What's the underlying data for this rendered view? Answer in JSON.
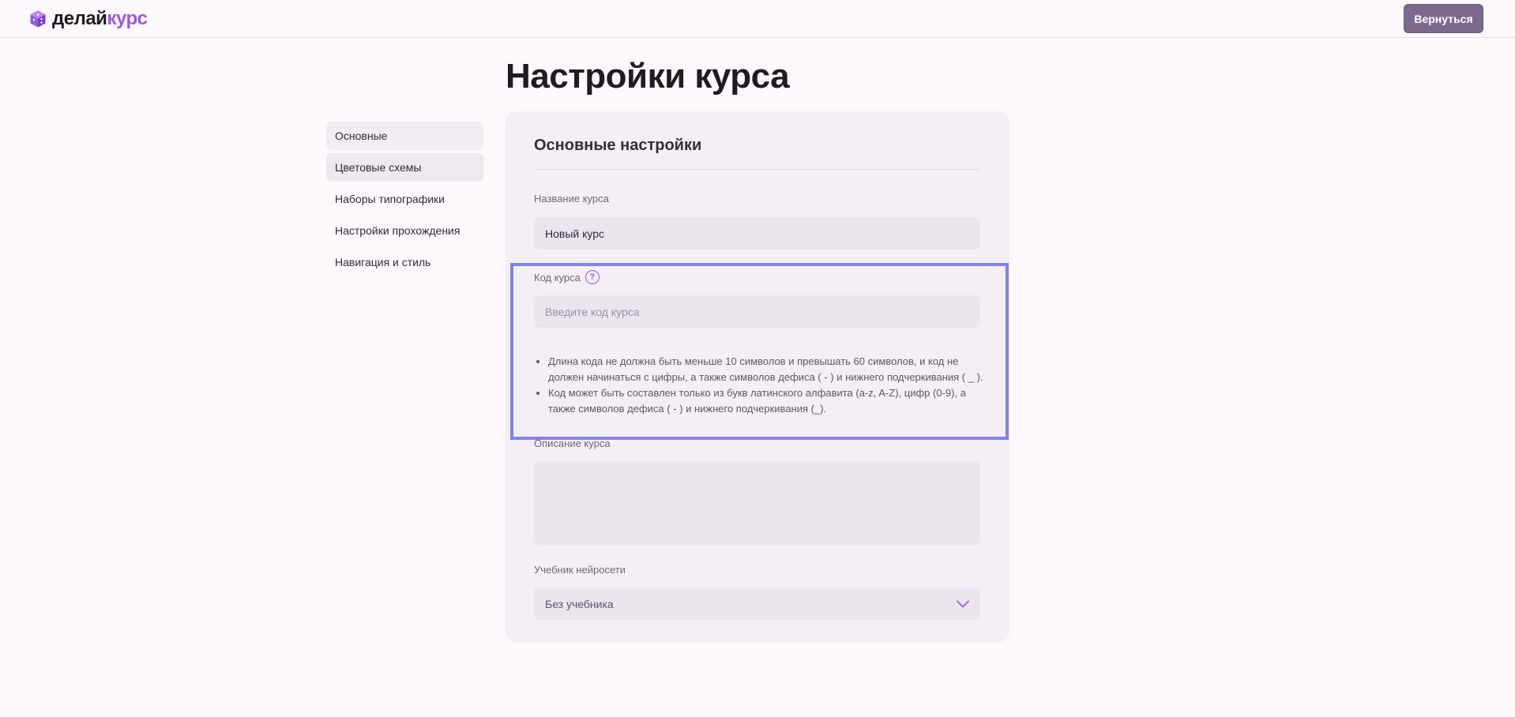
{
  "header": {
    "logo_part1": "делай",
    "logo_part2": "курс",
    "back_label": "Вернуться"
  },
  "page": {
    "title": "Настройки курса"
  },
  "sidebar": {
    "items": [
      {
        "label": "Основные"
      },
      {
        "label": "Цветовые схемы"
      },
      {
        "label": "Наборы типографики"
      },
      {
        "label": "Настройки прохождения"
      },
      {
        "label": "Навигация и стиль"
      }
    ]
  },
  "card": {
    "title": "Основные настройки",
    "course_name": {
      "label": "Название курса",
      "value": "Новый курс"
    },
    "course_code": {
      "label": "Код курса",
      "help_glyph": "?",
      "placeholder": "Введите код курса",
      "rules": [
        "Длина кода не должна быть меньше 10 символов и превышать 60 символов, и код не должен начинаться с цифры, а также символов дефиса ( - ) и нижнего подчеркивания ( _ ).",
        "Код может быть составлен только из букв латинского алфавита (a-z, A-Z), цифр (0-9), а также символов дефиса ( - ) и нижнего подчеркивания (_)."
      ]
    },
    "course_description": {
      "label": "Описание курса",
      "value": ""
    },
    "ai_textbook": {
      "label": "Учебник нейросети",
      "selected": "Без учебника"
    }
  },
  "colors": {
    "accent": "#9a5ae0",
    "button": "#7b6a8e",
    "highlight": "#7f83e8"
  }
}
